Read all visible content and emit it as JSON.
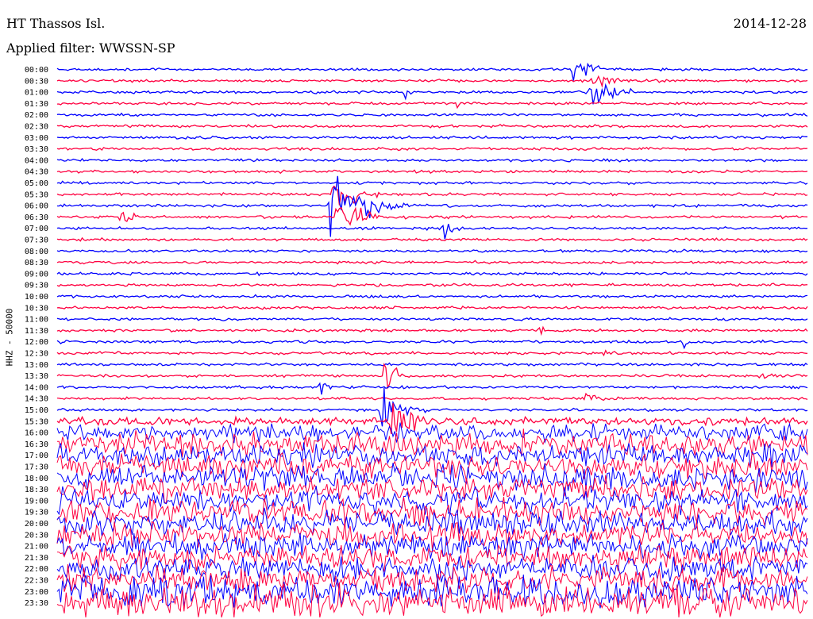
{
  "header": {
    "station": "HT Thassos Isl.",
    "date": "2014-12-28",
    "filter": "Applied filter: WWSSN-SP"
  },
  "chart_data": {
    "type": "line",
    "ylabel": "HHZ - 50000",
    "colors": {
      "even": "#0000ff",
      "odd": "#ff0040"
    },
    "time_labels": [
      "00:00",
      "00:30",
      "01:00",
      "01:30",
      "02:00",
      "02:30",
      "03:00",
      "03:30",
      "04:00",
      "04:30",
      "05:00",
      "05:30",
      "06:00",
      "06:30",
      "07:00",
      "07:30",
      "08:00",
      "08:30",
      "09:00",
      "09:30",
      "10:00",
      "10:30",
      "11:00",
      "11:30",
      "12:00",
      "12:30",
      "13:00",
      "13:30",
      "14:00",
      "14:30",
      "15:00",
      "15:30",
      "16:00",
      "16:30",
      "17:00",
      "17:30",
      "18:00",
      "18:30",
      "19:00",
      "19:30",
      "20:00",
      "20:30",
      "21:00",
      "21:30",
      "22:00",
      "22:30",
      "23:00",
      "23:30"
    ]
  }
}
